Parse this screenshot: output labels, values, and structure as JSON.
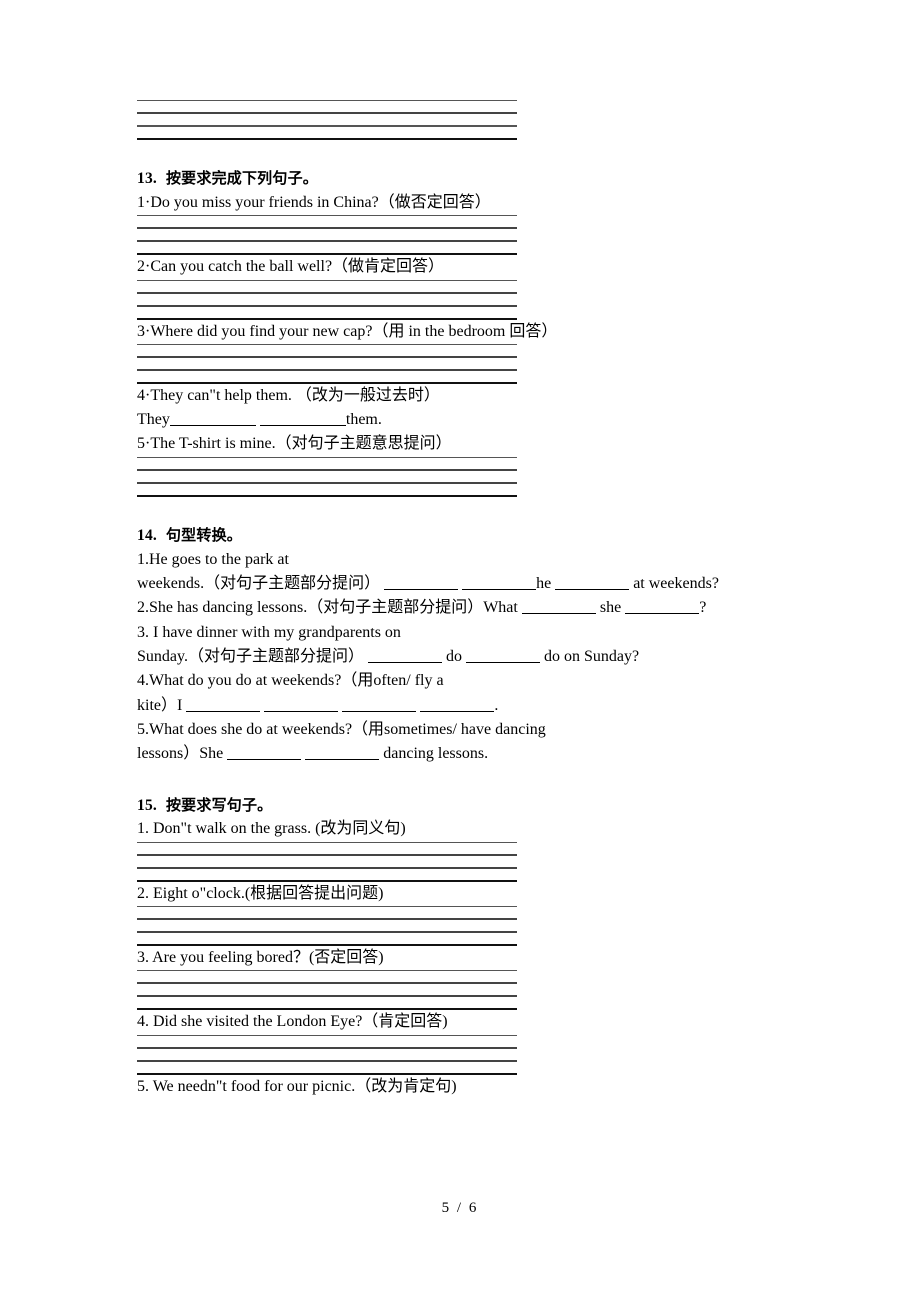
{
  "document": {
    "footer_page": "5 / 6"
  },
  "top_rules": {
    "count": 4
  },
  "sections": [
    {
      "number": "13.",
      "title": "按要求完成下列句子。",
      "items": [
        {
          "text": "1·Do you miss your friends in China?（做否定回答）",
          "rules": 4
        },
        {
          "text": "2·Can you catch the ball well?（做肯定回答）",
          "rules": 4
        },
        {
          "text": "3·Where did you find your new cap?（用 in the bedroom 回答）",
          "rules": 4
        },
        {
          "text": "4·They can\"t help them. （改为一般过去时）",
          "rules": 0
        },
        {
          "text_pre": "They",
          "text_post": "them.",
          "blanks": 2,
          "rules": 0
        },
        {
          "text": "5·The T-shirt is mine.（对句子主题意思提问）",
          "rules": 4
        }
      ]
    },
    {
      "number": "14.",
      "title": "句型转换。",
      "items": [
        {
          "text": "1.He goes to the park at",
          "rules": 0
        },
        {
          "text_pre": "weekends.（对句子主题部分提问）",
          "mid": "he",
          "text_post": "at weekends?",
          "pattern": "b b mid b post",
          "rules": 0
        },
        {
          "text_pre": "2.She has dancing lessons.（对句子主题部分提问）What",
          "mid": "she",
          "text_post": "?",
          "pattern": "pre b mid b post",
          "rules": 0
        },
        {
          "text": "3. I have dinner with my grandparents on",
          "rules": 0
        },
        {
          "text_pre": "Sunday.（对句子主题部分提问）",
          "mid": "do",
          "text_post": "do on Sunday?",
          "pattern": "pre b mid b post",
          "rules": 0
        },
        {
          "text": "4.What do you do at weekends?（用often/ fly a",
          "rules": 0
        },
        {
          "text_pre": "kite）I",
          "text_post": ".",
          "blanks": 4,
          "rules": 0
        },
        {
          "text": "5.What does she do at weekends?（用sometimes/ have dancing",
          "rules": 0
        },
        {
          "text_pre": "lessons）She",
          "text_post": "dancing lessons.",
          "blanks": 2,
          "rules": 0
        }
      ]
    },
    {
      "number": "15.",
      "title": "按要求写句子。",
      "items": [
        {
          "text": "1. Don\"t walk on the grass. (改为同义句)",
          "rules": 4
        },
        {
          "text": "2. Eight o\"clock.(根据回答提出问题)",
          "rules": 4
        },
        {
          "text": "3. Are you feeling bored？(否定回答)",
          "rules": 4
        },
        {
          "text": "4. Did she visited the London Eye?（肯定回答)",
          "rules": 4
        },
        {
          "text": "5. We needn\"t food for our picnic.（改为肯定句)",
          "rules": 0
        }
      ]
    }
  ]
}
